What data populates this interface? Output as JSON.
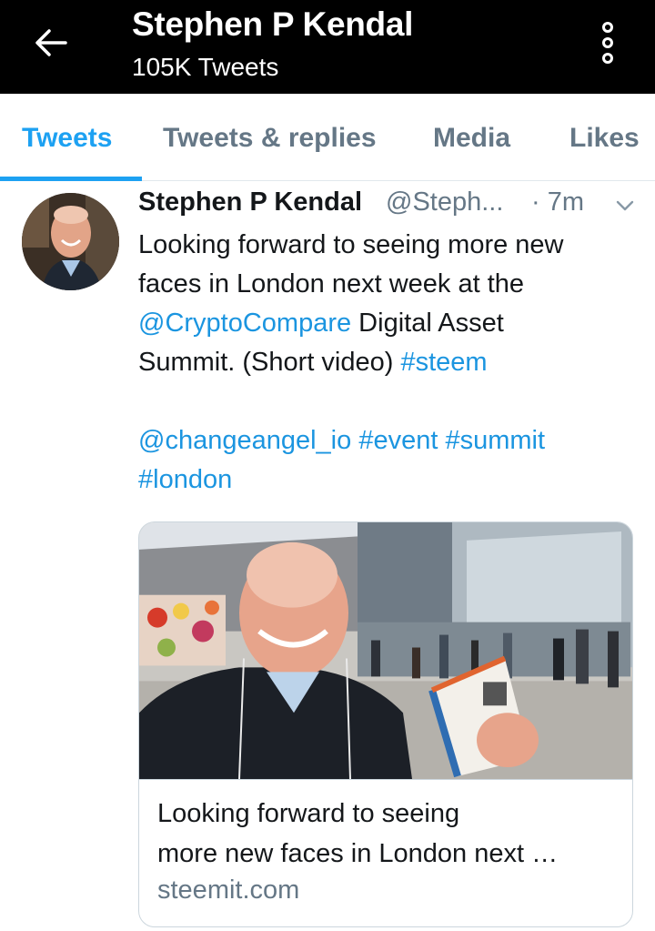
{
  "header": {
    "title": "Stephen P Kendal",
    "subtitle": "105K Tweets",
    "back_icon": "arrow-left-icon",
    "more_icon": "more-vertical-icon"
  },
  "tabs": [
    {
      "label": "Tweets",
      "active": true
    },
    {
      "label": "Tweets & replies",
      "active": false
    },
    {
      "label": "Media",
      "active": false
    },
    {
      "label": "Likes",
      "active": false
    }
  ],
  "tweet": {
    "author_name": "Stephen P Kendal",
    "author_handle": "@Steph...",
    "time": "· 7m",
    "text": {
      "l1": "Looking forward to seeing more new",
      "l2": "faces in London next week at the",
      "l3_mention": "@CryptoCompare",
      "l3_rest": " Digital Asset",
      "l4_text": "Summit. (Short video) ",
      "l4_tag": "#steem",
      "l5_mention": "@changeangel_io",
      "l5_tag1": "#event",
      "l5_tag2": "#summit",
      "l6_tag": "#london"
    },
    "card": {
      "title_line1": "Looking forward to seeing",
      "title_line2": "more new faces in London next …",
      "domain": "steemit.com"
    }
  },
  "colors": {
    "accent": "#1da1f2",
    "link": "#1b95e0",
    "header_bg": "#000000",
    "muted": "#657786"
  }
}
